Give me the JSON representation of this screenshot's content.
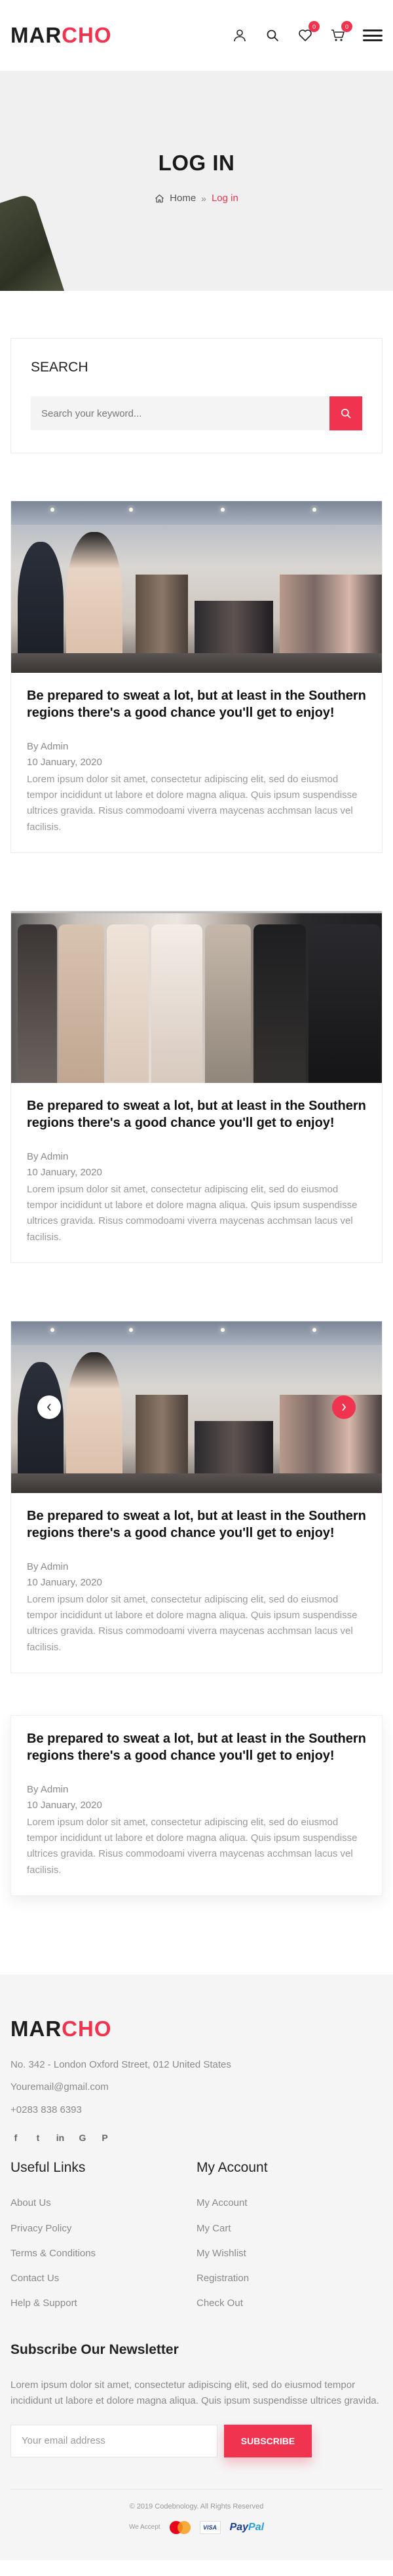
{
  "header": {
    "logo_part1": "MAR",
    "logo_part2": "CHO",
    "wishlist_count": "0",
    "cart_count": "0"
  },
  "banner": {
    "title": "LOG IN",
    "breadcrumb": {
      "home": "Home",
      "separator": "»",
      "current": "Log in"
    }
  },
  "search": {
    "title": "SEARCH",
    "placeholder": "Search your keyword..."
  },
  "posts": [
    {
      "title": "Be prepared to sweat a lot, but at least in the Southern regions there's a good chance you'll get to enjoy!",
      "author": "By Admin",
      "date": "10 January, 2020",
      "excerpt": "Lorem ipsum dolor sit amet, consectetur adipiscing elit, sed do eiusmod tempor incididunt ut labore et dolore magna aliqua. Quis ipsum suspendisse ultrices gravida. Risus commodoami viverra maycenas acchmsan lacus vel facilisis."
    },
    {
      "title": "Be prepared to sweat a lot, but at least in the Southern regions there's a good chance you'll get to enjoy!",
      "author": "By Admin",
      "date": "10 January, 2020",
      "excerpt": "Lorem ipsum dolor sit amet, consectetur adipiscing elit, sed do eiusmod tempor incididunt ut labore et dolore magna aliqua. Quis ipsum suspendisse ultrices gravida. Risus commodoami viverra maycenas acchmsan lacus vel facilisis."
    },
    {
      "title": "Be prepared to sweat a lot, but at least in the Southern regions there's a good chance you'll get to enjoy!",
      "author": "By Admin",
      "date": "10 January, 2020",
      "excerpt": "Lorem ipsum dolor sit amet, consectetur adipiscing elit, sed do eiusmod tempor incididunt ut labore et dolore magna aliqua. Quis ipsum suspendisse ultrices gravida. Risus commodoami viverra maycenas acchmsan lacus vel facilisis."
    },
    {
      "title": "Be prepared to sweat a lot, but at least in the Southern regions there's a good chance you'll get to enjoy!",
      "author": "By Admin",
      "date": "10 January, 2020",
      "excerpt": "Lorem ipsum dolor sit amet, consectetur adipiscing elit, sed do eiusmod tempor incididunt ut labore et dolore magna aliqua. Quis ipsum suspendisse ultrices gravida. Risus commodoami viverra maycenas acchmsan lacus vel facilisis."
    }
  ],
  "footer": {
    "logo_part1": "MAR",
    "logo_part2": "CHO",
    "address": "No. 342 - London Oxford Street, 012 United States",
    "email": "Youremail@gmail.com",
    "phone": "+0283 838 6393",
    "social_icons": [
      "facebook-icon",
      "twitter-icon",
      "linkedin-icon",
      "google-icon",
      "pinterest-icon"
    ],
    "social_glyphs": [
      "f",
      "t",
      "in",
      "G",
      "P"
    ],
    "useful_links_title": "Useful Links",
    "useful_links": [
      "About Us",
      "Privacy Policy",
      "Terms & Conditions",
      "Contact Us",
      "Help & Support"
    ],
    "account_title": "My Account",
    "account_links": [
      "My Account",
      "My Cart",
      "My Wishlist",
      "Registration",
      "Check Out"
    ],
    "subscribe_title": "Subscribe Our Newsletter",
    "subscribe_text": "Lorem ipsum dolor sit amet, consectetur adipiscing elit, sed do eiusmod tempor incididunt ut labore et dolore magna aliqua. Quis ipsum suspendisse ultrices gravida.",
    "email_placeholder": "Your email address",
    "subscribe_button": "SUBSCRIBE",
    "copyright": "© 2019 Codebnology. All Rights Reserved",
    "we_accept": "We Accept",
    "visa": "VISA",
    "paypal_1": "Pay",
    "paypal_2": "Pal"
  },
  "colors": {
    "accent": "#f0334f",
    "text_dark": "#222222",
    "text_muted": "#8a8a8a",
    "banner_bg": "#f0f0f1",
    "footer_bg": "#f5f5f5"
  }
}
